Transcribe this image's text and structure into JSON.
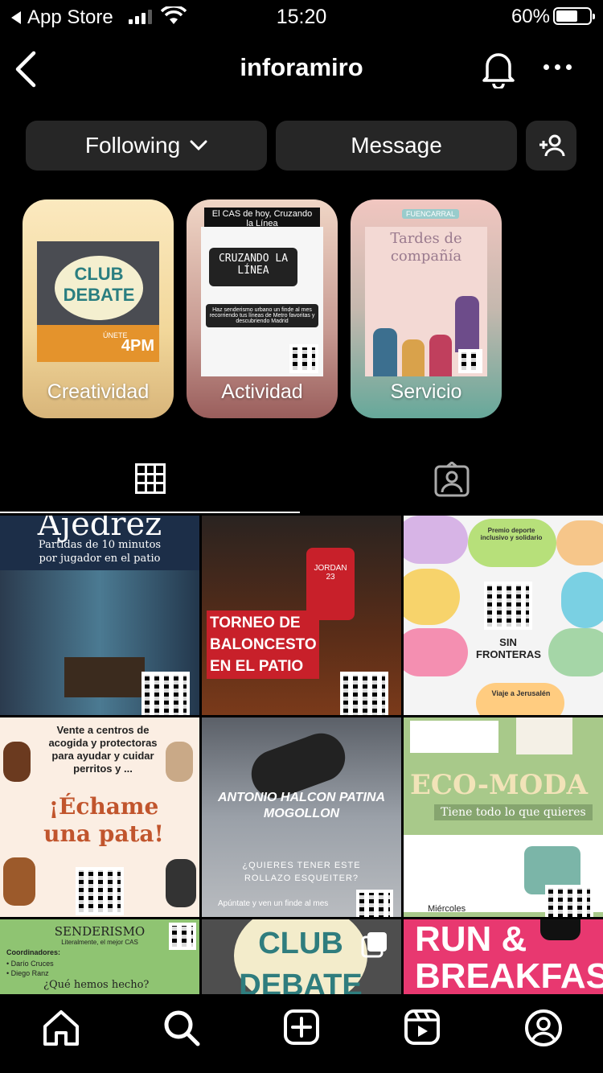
{
  "status_bar": {
    "back_app": "App Store",
    "time": "15:20",
    "battery": "60%",
    "battery_level": 0.6
  },
  "header": {
    "username": "inforamiro"
  },
  "actions": {
    "following_label": "Following",
    "message_label": "Message"
  },
  "highlights": [
    {
      "label": "Creatividad",
      "cover_title": "CLUB DEBATE",
      "cover_sub": "ÚNETE",
      "cover_time": "4PM"
    },
    {
      "label": "Actividad",
      "cover_caption": "El CAS de hoy, Cruzando la Línea",
      "cover_title": "CRUZANDO LA LÍNEA",
      "cover_text": "Haz senderismo urbano un finde al mes recorriendo tus líneas de Metro favoritas y descubriendo Madrid"
    },
    {
      "label": "Servicio",
      "cover_caption": "FUENCARRAL",
      "cover_title": "Tardes de compañía"
    }
  ],
  "posts": [
    {
      "title": "Ajedrez",
      "text": "Partidas de 10 minutos por jugador en el patio"
    },
    {
      "title": "TORNEO DE BALONCESTO EN EL PATIO",
      "jersey": "JORDAN 23"
    },
    {
      "title": "SIN FRONTERAS",
      "tag1": "Premio deporte inclusivo y solidario",
      "tag2": "Viaje a Jerusalén"
    },
    {
      "title": "¡Échame una pata!",
      "text": "Vente a centros de acogida y protectoras para ayudar y cuidar perritos y ..."
    },
    {
      "title": "ANTONIO HALCON PATINA MOGOLLON",
      "text": "¿QUIERES TENER ESTE ROLLAZO ESQUEITER?",
      "sub": "Apúntate y ven un finde al mes"
    },
    {
      "title": "ECO-MODA",
      "text": "Tiene todo lo que quieres",
      "sub": "Miércoles"
    },
    {
      "title": "SENDERISMO",
      "sub": "Literalmente, el mejor CAS",
      "text": "¿Qué hemos hecho?",
      "coord_label": "Coordinadores:",
      "coords": [
        "• Darío Cruces",
        "• Diego Ranz"
      ]
    },
    {
      "title": "CLUB DEBATE"
    },
    {
      "title": "RUN & BREAKFAST"
    }
  ]
}
